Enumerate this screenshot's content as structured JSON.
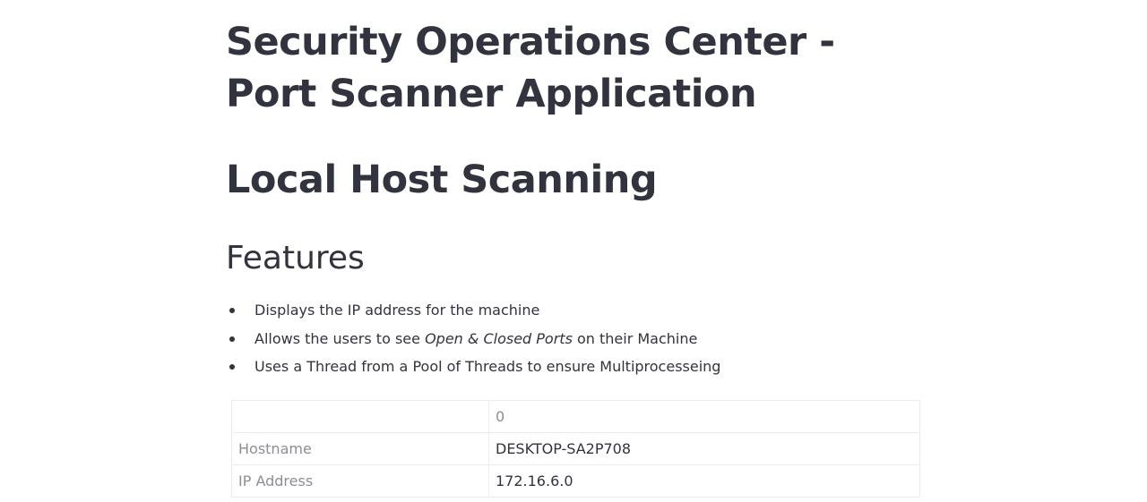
{
  "page": {
    "title": "Security Operations Center - Port Scanner Application",
    "subtitle": "Local Host Scanning",
    "features_heading": "Features",
    "features": [
      {
        "text": "Displays the IP address for the machine"
      },
      {
        "before": "Allows the users to see ",
        "emphasis": "Open & Closed Ports",
        "after": " on their Machine"
      },
      {
        "text": "Uses a Thread from a Pool of Threads to ensure Multiprocesseing"
      }
    ]
  },
  "table": {
    "header": [
      "",
      "0"
    ],
    "rows": [
      {
        "label": "Hostname",
        "value": "DESKTOP-SA2P708"
      },
      {
        "label": "IP Address",
        "value": "172.16.6.0"
      }
    ]
  }
}
